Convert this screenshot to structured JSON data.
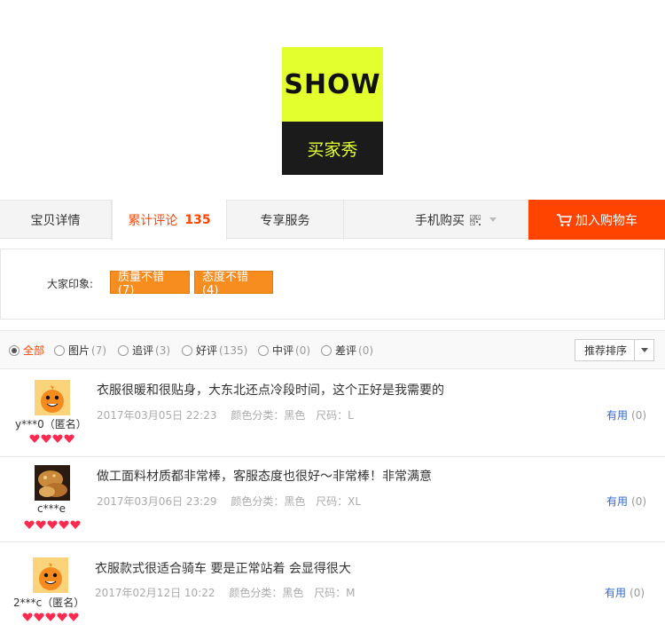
{
  "logo": {
    "top_text": "SHOW",
    "bottom_text": "买家秀"
  },
  "tabs": [
    {
      "label": "宝贝详情"
    },
    {
      "label": "累计评论",
      "count": "135"
    },
    {
      "label": "专享服务"
    }
  ],
  "mobile_buy_label": "手机购买",
  "cart_button_label": "加入购物车",
  "impressions": {
    "label": "大家印象:",
    "tags": [
      "质量不错 (7)",
      "态度不错 (4)"
    ]
  },
  "filters": [
    {
      "label": "全部",
      "count": ""
    },
    {
      "label": "图片",
      "count": "(7)"
    },
    {
      "label": "追评",
      "count": "(3)"
    },
    {
      "label": "好评",
      "count": "(135)"
    },
    {
      "label": "中评",
      "count": "(0)"
    },
    {
      "label": "差评",
      "count": "(0)"
    }
  ],
  "sort_label": "推荐排序",
  "reviews": [
    {
      "user": "y***0（匿名）",
      "avatar": "orange-mascot",
      "hearts": 4,
      "content": "衣服很暖和很贴身，大东北还点冷段时间，这个正好是我需要的",
      "date": "2017年03月05日 22:23",
      "color": "颜色分类：黑色",
      "size": "尺码：L",
      "useful_label": "有用",
      "useful_count": "(0)"
    },
    {
      "user": "c***e",
      "avatar": "bread-photo",
      "hearts": 5,
      "content": "做工面料材质都非常棒，客服态度也很好～非常棒！非常满意",
      "date": "2017年03月06日 23:29",
      "color": "颜色分类：黑色",
      "size": "尺码：XL",
      "useful_label": "有用",
      "useful_count": "(0)"
    },
    {
      "user": "2***c（匿名）",
      "avatar": "orange-mascot",
      "hearts": 5,
      "content": "衣服款式很适合骑车 要是正常站着 会显得很大",
      "date": "2017年02月12日 10:22",
      "color": "颜色分类：黑色",
      "size": "尺码：M",
      "useful_label": "有用",
      "useful_count": "(0)"
    }
  ],
  "colors": {
    "accent": "#ff4400",
    "tag": "#f78c1f",
    "logo_yellow": "#e4ff2e",
    "link": "#3366cc"
  }
}
